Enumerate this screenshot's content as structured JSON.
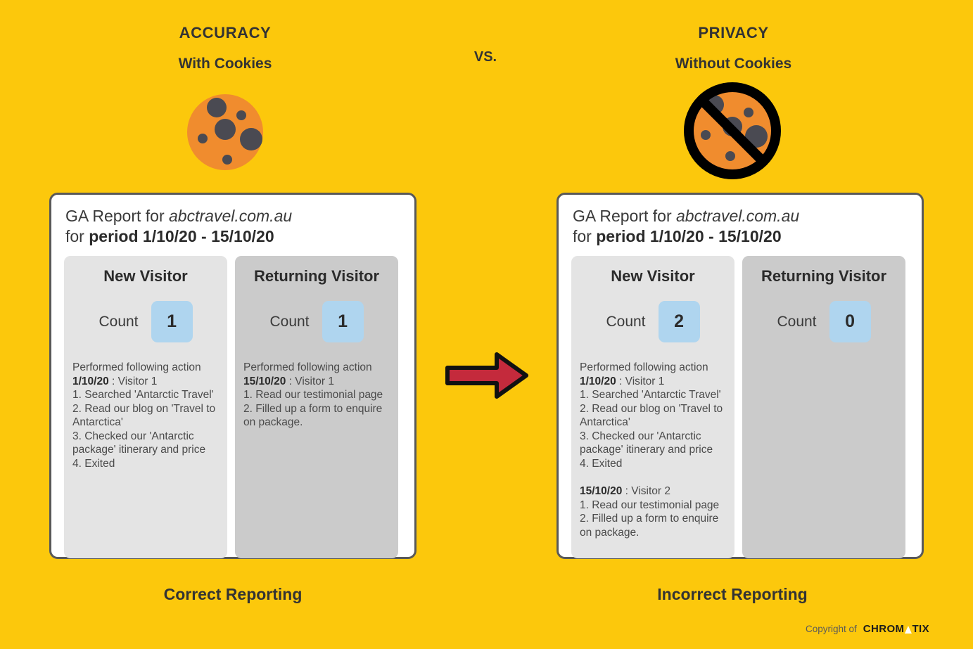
{
  "page": {
    "background_color": "#FCC80C",
    "text_color": "#333333"
  },
  "left_heading": {
    "kicker": "ACCURACY",
    "subtitle": "With Cookies"
  },
  "right_heading": {
    "kicker": "PRIVACY",
    "subtitle": "Without Cookies"
  },
  "vs_label": "VS.",
  "icons": {
    "cookie": {
      "name": "cookie-icon",
      "body_color": "#F08C2E",
      "chip_color": "#4A4A52"
    },
    "no_cookie": {
      "name": "no-cookie-icon",
      "body_color": "#F08C2E",
      "chip_color": "#4A4A52",
      "ban_color": "#000000"
    },
    "arrow": {
      "name": "right-arrow-icon",
      "fill_color": "#C42A3C",
      "stroke_color": "#111111"
    }
  },
  "cards": [
    {
      "id": "left",
      "title_prefix": "GA Report for ",
      "site": "abctravel.com.au",
      "title_line2_prefix": "for ",
      "period": "period 1/10/20 - 15/10/20",
      "panels": [
        {
          "type": "new",
          "title": "New Visitor",
          "count_label": "Count",
          "count_value": "1",
          "activity_lead": "Performed following action",
          "groups": [
            {
              "date": "1/10/20",
              "visitor": " : Visitor 1",
              "steps": [
                "1. Searched 'Antarctic Travel'",
                "2. Read our blog on 'Travel to Antarctica'",
                "3. Checked our 'Antarctic package' itinerary and price",
                "4. Exited"
              ]
            }
          ]
        },
        {
          "type": "returning",
          "title": "Returning Visitor",
          "count_label": "Count",
          "count_value": "1",
          "activity_lead": "Performed following action",
          "groups": [
            {
              "date": "15/10/20",
              "visitor": " : Visitor 1",
              "steps": [
                "1. Read our testimonial page",
                "2. Filled up a form to enquire on package."
              ]
            }
          ]
        }
      ],
      "caption": "Correct Reporting"
    },
    {
      "id": "right",
      "title_prefix": "GA Report for ",
      "site": "abctravel.com.au",
      "title_line2_prefix": "for ",
      "period": "period 1/10/20 - 15/10/20",
      "panels": [
        {
          "type": "new",
          "title": "New Visitor",
          "count_label": "Count",
          "count_value": "2",
          "activity_lead": "Performed following action",
          "groups": [
            {
              "date": "1/10/20",
              "visitor": " : Visitor 1",
              "steps": [
                "1. Searched 'Antarctic Travel'",
                "2. Read our blog on 'Travel to Antarctica'",
                "3. Checked our 'Antarctic package' itinerary and price",
                "4. Exited"
              ]
            },
            {
              "date": "15/10/20",
              "visitor": " : Visitor 2",
              "steps": [
                "1. Read our testimonial page",
                "2. Filled up a form to enquire on package."
              ]
            }
          ]
        },
        {
          "type": "returning",
          "title": "Returning Visitor",
          "count_label": "Count",
          "count_value": "0",
          "activity_lead": "",
          "groups": []
        }
      ],
      "caption": "Incorrect Reporting"
    }
  ],
  "footer": {
    "copyright_text": "Copyright of",
    "brand_part1": "CHROM",
    "brand_part2": "TIX"
  }
}
